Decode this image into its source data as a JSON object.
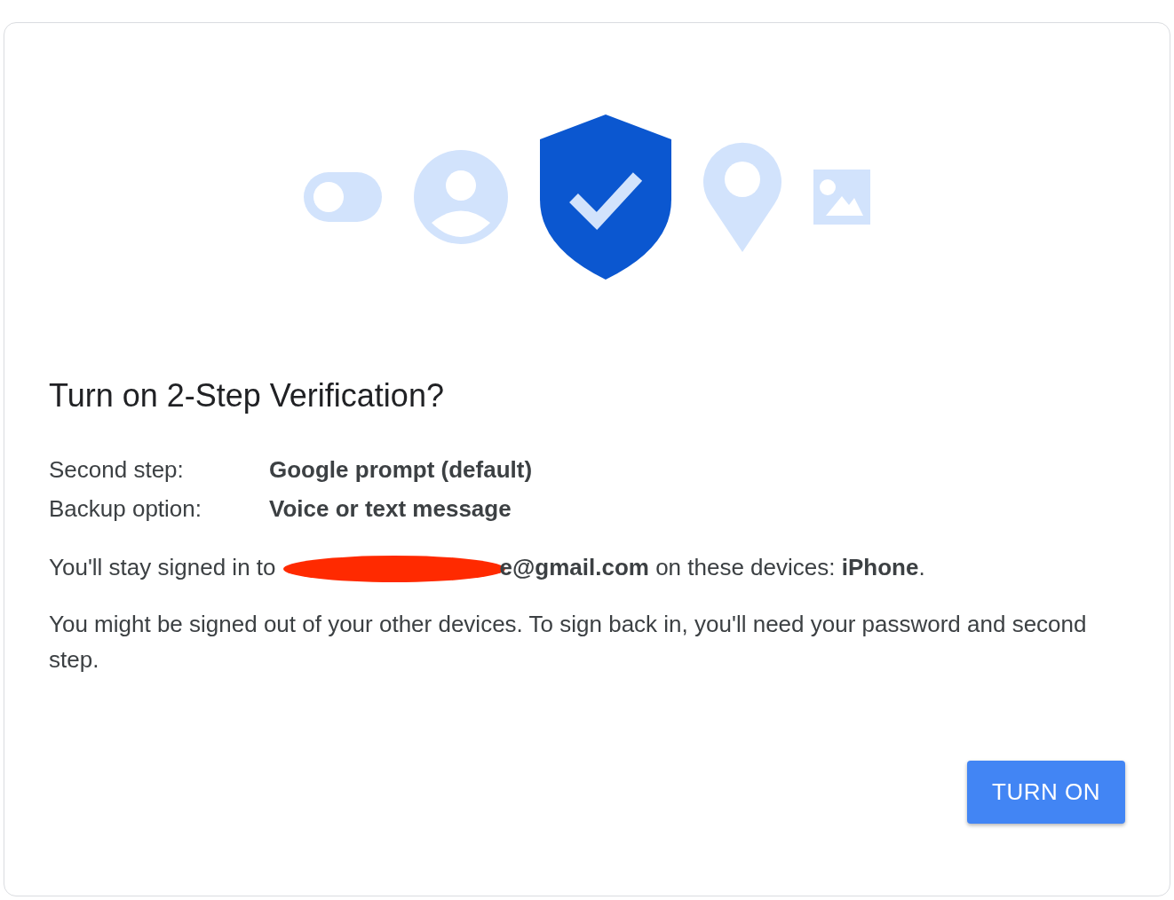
{
  "dialog": {
    "title": "Turn on 2-Step Verification?",
    "details": [
      {
        "label": "Second step:",
        "value": "Google prompt (default)"
      },
      {
        "label": "Backup option:",
        "value": "Voice or text message"
      }
    ],
    "signed_in": {
      "before": "You'll stay signed in to",
      "redacted": true,
      "after": "**e@gmail.com** on these devices: **iPhone**."
    },
    "note": "You might be signed out of your other devices. To sign back in, you'll need your password and second step.",
    "button": "TURN ON"
  }
}
